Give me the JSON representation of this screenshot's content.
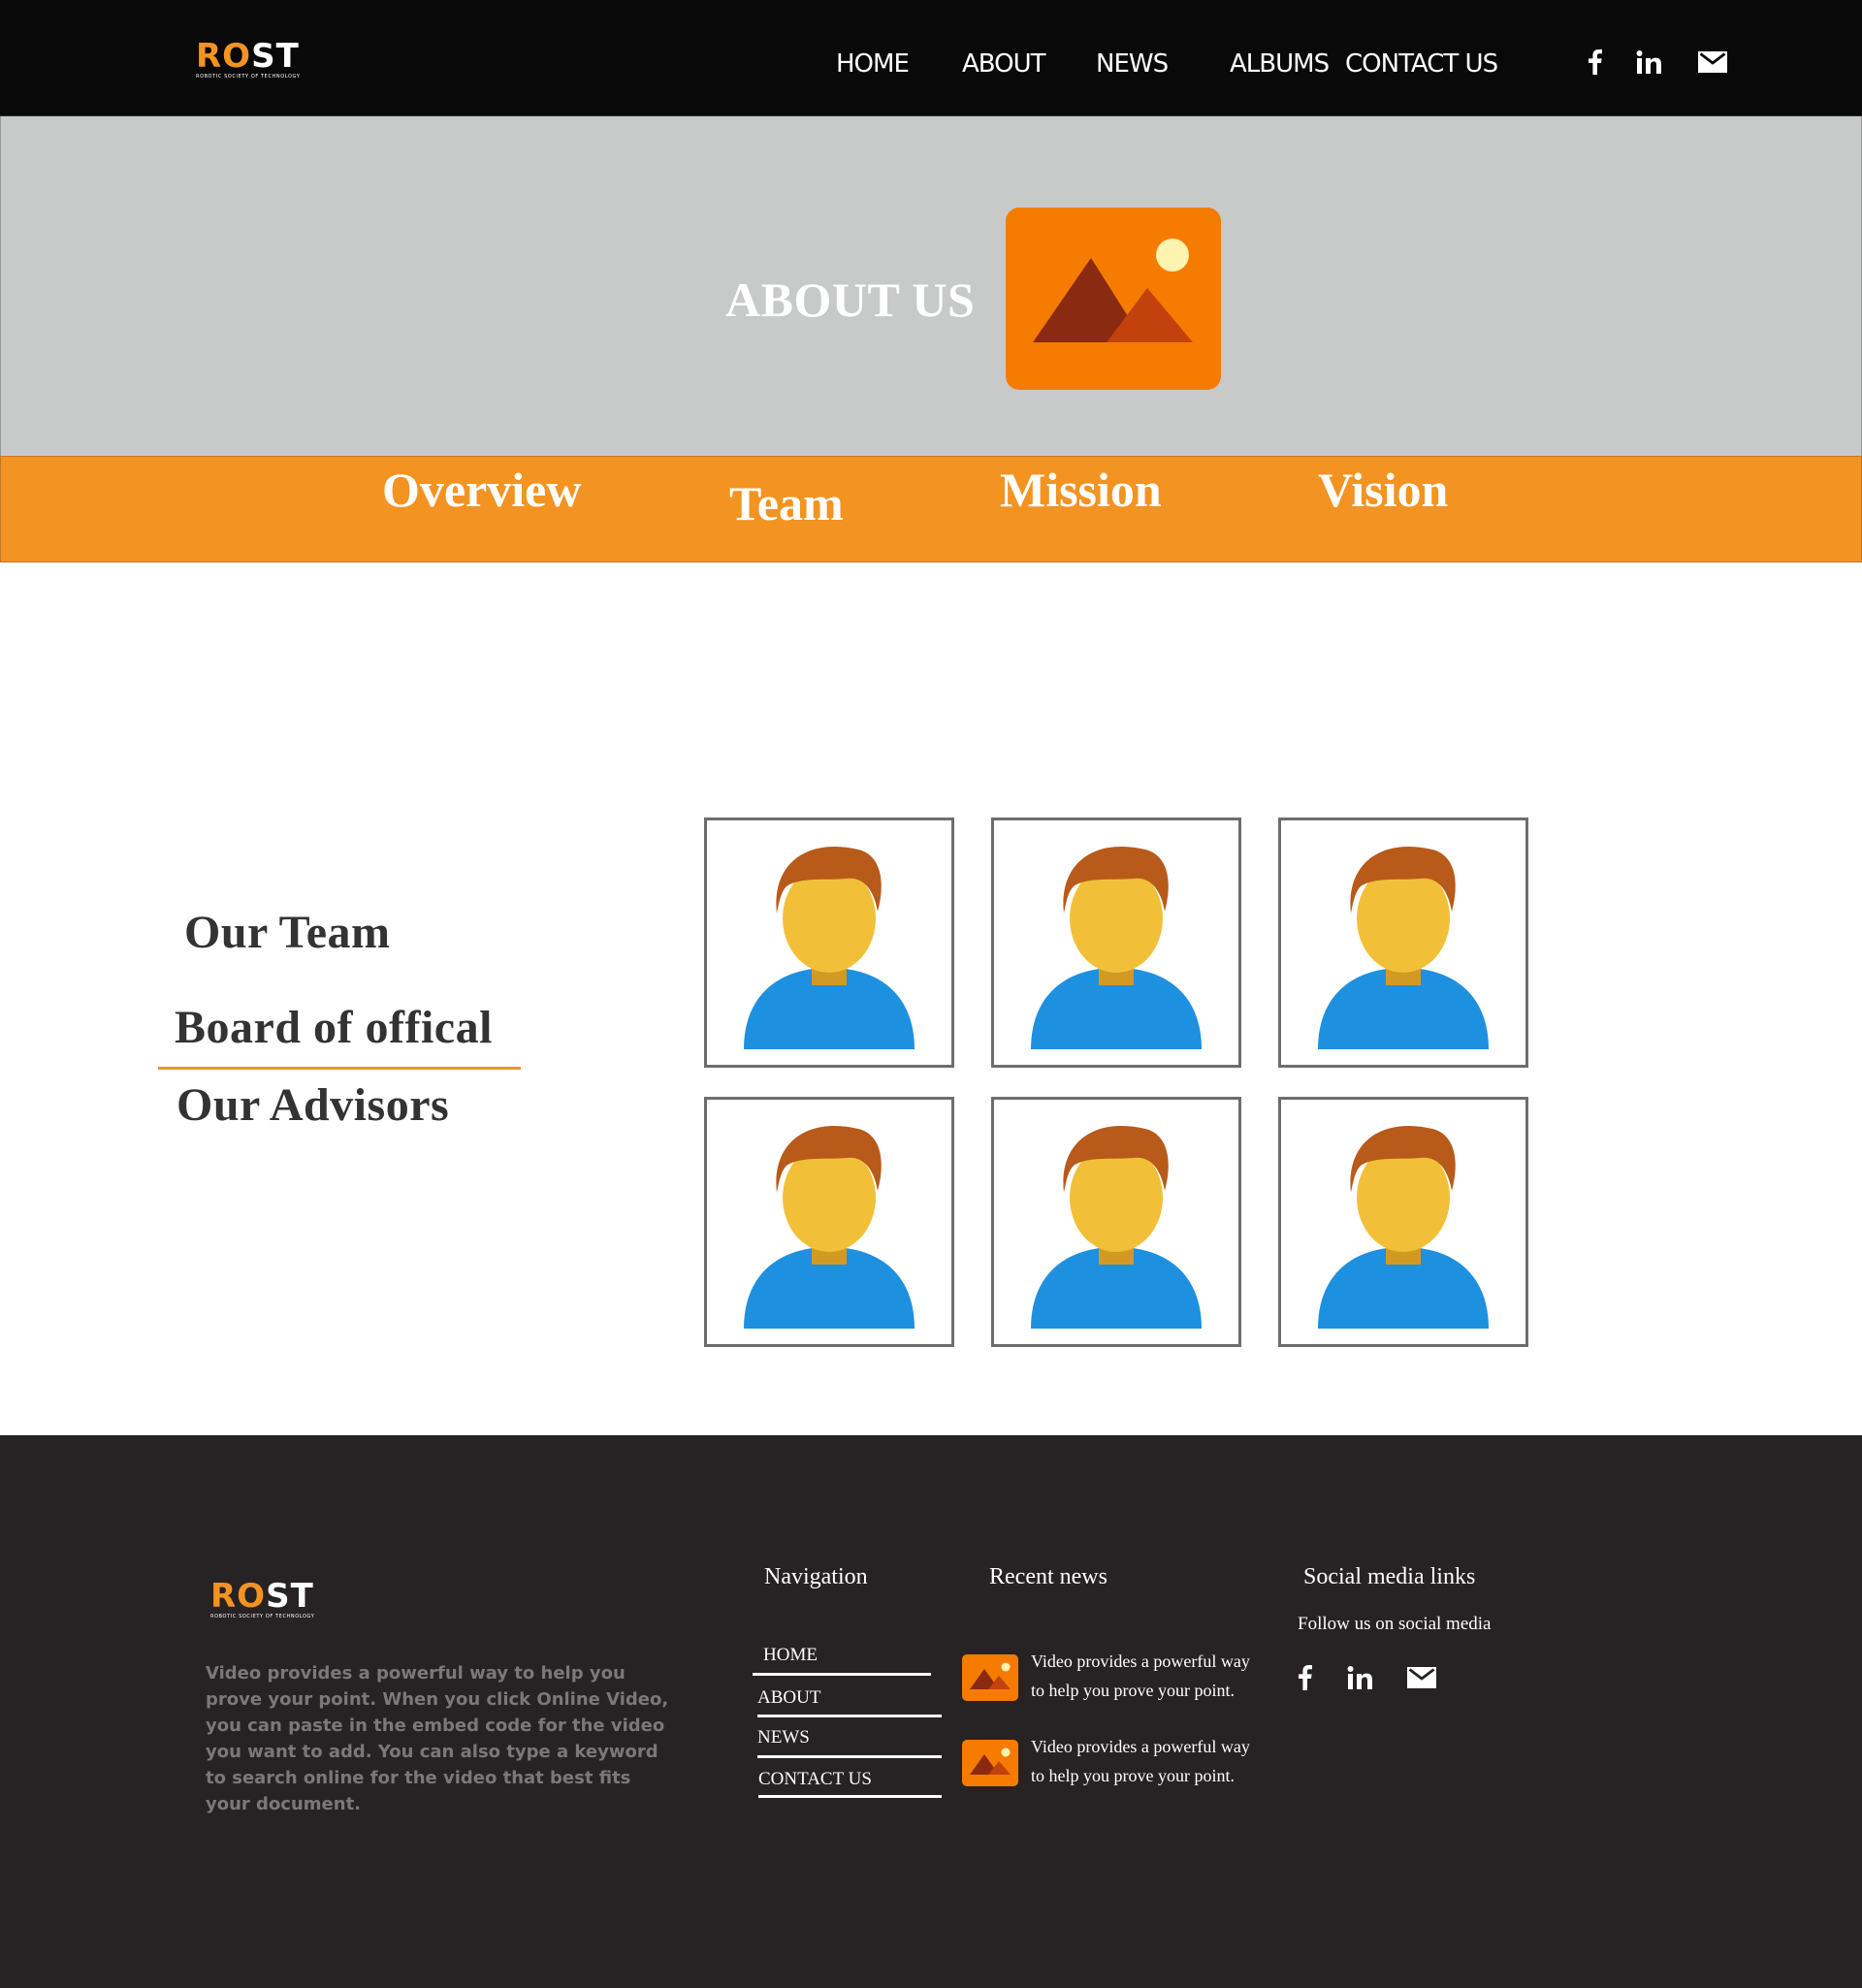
{
  "header": {
    "logo": {
      "text_a": "RO",
      "text_b": "ST",
      "subtitle": "ROBOTIC SOCIETY OF TECHNOLOGY"
    },
    "nav": [
      "HOME",
      "ABOUT",
      "NEWS",
      "ALBUMS",
      "CONTACT US"
    ],
    "social_icons": [
      "facebook-icon",
      "linkedin-icon",
      "mail-icon"
    ]
  },
  "hero": {
    "title": "ABOUT US",
    "image_icon": "image-placeholder-icon"
  },
  "tabs": [
    "Overview",
    "Team",
    "Mission",
    "Vision"
  ],
  "team": {
    "side_menu": [
      "Our Team",
      "Board of offical",
      "Our Advisors"
    ],
    "active_item": "Board of offical",
    "member_icon": "user-avatar-icon",
    "member_count": 6
  },
  "footer": {
    "logo": {
      "text_a": "RO",
      "text_b": "ST",
      "subtitle": "ROBOTIC SOCIETY OF TECHNOLOGY"
    },
    "description": "Video provides a powerful way to help you prove your point. When you click Online Video, you can paste in the embed code for the video you want to add. You can also type a keyword to search online for the video that best fits your document.",
    "navigation": {
      "heading": "Navigation",
      "links": [
        "HOME",
        "ABOUT",
        "NEWS",
        "CONTACT US"
      ]
    },
    "recent_news": {
      "heading": "Recent news",
      "items": [
        "Video provides a powerful way to help you prove your point.",
        "Video provides a powerful way to help you prove your point."
      ]
    },
    "social": {
      "heading": "Social media links",
      "follow_text": "Follow us on social media",
      "icons": [
        "facebook-icon",
        "linkedin-icon",
        "mail-icon"
      ]
    }
  },
  "colors": {
    "accent": "#f39322",
    "navbar": "#090909",
    "hero_bg": "#c8cac9",
    "footer_bg": "#272223",
    "image_orange": "#f57c00"
  }
}
